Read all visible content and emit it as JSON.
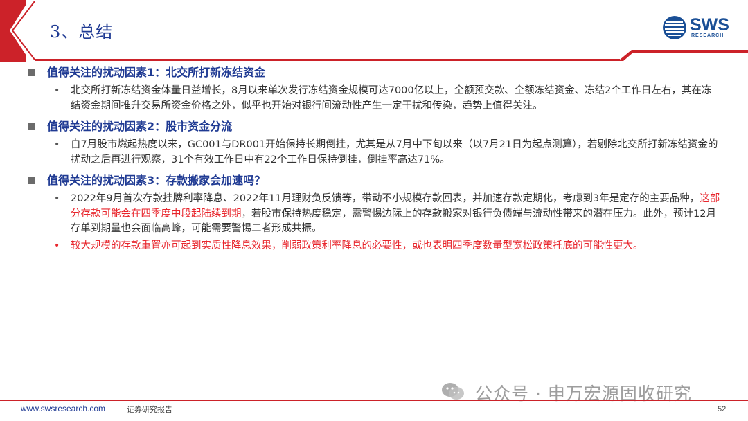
{
  "header": {
    "title": "3、总结",
    "logo_text": "SWS",
    "logo_sub": "RESEARCH",
    "accent_color": "#cc2229",
    "title_color": "#1f3a93"
  },
  "sections": [
    {
      "heading": "值得关注的扰动因素1：北交所打新冻结资金",
      "bullets": [
        {
          "text": "北交所打新冻结资金体量日益增长，8月以来单次发行冻结资金规模可达7000亿以上，全额预交款、全额冻结资金、冻结2个工作日左右，其在冻结资金期间推升交易所资金价格之外，似乎也开始对银行间流动性产生一定干扰和传染，趋势上值得关注。"
        }
      ]
    },
    {
      "heading": "值得关注的扰动因素2：股市资金分流",
      "bullets": [
        {
          "text": "自7月股市燃起热度以来，GC001与DR001开始保持长期倒挂，尤其是从7月中下旬以来（以7月21日为起点测算），若剔除北交所打新冻结资金的扰动之后再进行观察，31个有效工作日中有22个工作日保持倒挂，倒挂率高达71%。"
        }
      ]
    },
    {
      "heading": "值得关注的扰动因素3：存款搬家会加速吗？",
      "bullets": [
        {
          "text_a": "2022年9月首次存款挂牌利率降息、2022年11月理财负反馈等，带动不小规模存款回表，并加速存款定期化，考虑到3年是定存的主要品种，",
          "text_red": "这部分存款可能会在四季度中段起陆续到期",
          "text_b": "，若股市保持热度稳定，需警惕边际上的存款搬家对银行负债端与流动性带来的潜在压力。此外，预计12月存单到期量也会面临高峰，可能需要警惕二者形成共振。"
        },
        {
          "text": "较大规模的存款重置亦可起到实质性降息效果，削弱政策利率降息的必要性，或也表明四季度数量型宽松政策托底的可能性更大。"
        }
      ]
    }
  ],
  "footer": {
    "url": "www.swsresearch.com",
    "doc_type": "证券研究报告",
    "page": "52"
  },
  "watermark": {
    "text": "公众号 · 申万宏源固收研究",
    "icon": "wechat-icon"
  }
}
